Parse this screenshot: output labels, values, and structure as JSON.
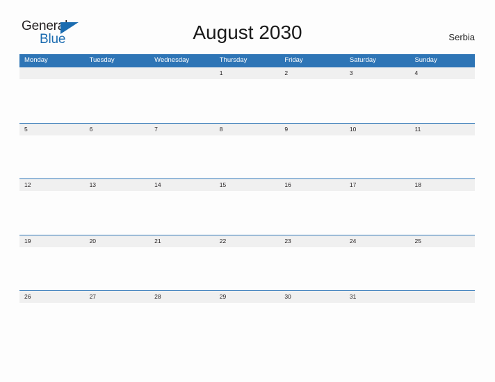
{
  "brand": {
    "line1": "General",
    "line2": "Blue",
    "triangle_icon": "sail-triangle-icon",
    "color_dark": "#231f20",
    "color_blue": "#1b6cb0"
  },
  "header": {
    "title": "August 2030",
    "country": "Serbia"
  },
  "theme": {
    "header_blue": "#2e75b6",
    "band_gray": "#f0f0f0",
    "page_background": "#fdfdfd",
    "text_dark": "#231f20"
  },
  "calendar": {
    "month": "August",
    "year": "2030",
    "weekday_headers": [
      "Monday",
      "Tuesday",
      "Wednesday",
      "Thursday",
      "Friday",
      "Saturday",
      "Sunday"
    ],
    "weeks": [
      [
        "",
        "",
        "",
        "1",
        "2",
        "3",
        "4"
      ],
      [
        "5",
        "6",
        "7",
        "8",
        "9",
        "10",
        "11"
      ],
      [
        "12",
        "13",
        "14",
        "15",
        "16",
        "17",
        "18"
      ],
      [
        "19",
        "20",
        "21",
        "22",
        "23",
        "24",
        "25"
      ],
      [
        "26",
        "27",
        "28",
        "29",
        "30",
        "31",
        ""
      ]
    ]
  }
}
